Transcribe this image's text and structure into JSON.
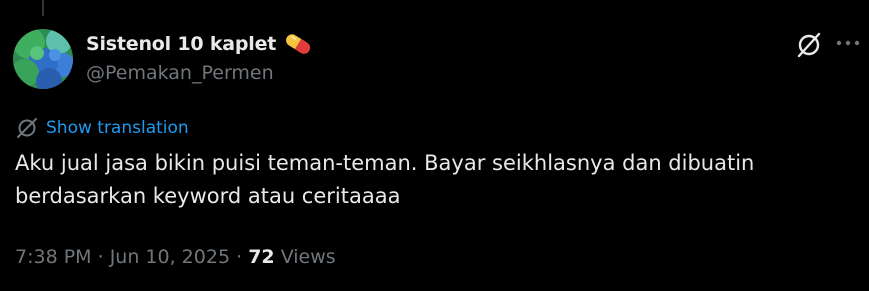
{
  "tweet": {
    "author": {
      "display_name": "Sistenol 10 kaplet",
      "emoji": "pill-icon",
      "handle": "@Pemakan_Permen"
    },
    "actions": {
      "grok_icon": "grok-icon",
      "more_icon": "more-icon"
    },
    "translate": {
      "icon": "translate-icon",
      "label": "Show translation"
    },
    "text": "Aku jual jasa bikin puisi teman-teman. Bayar seikhlasnya dan dibuatin berdasarkan keyword atau ceritaaaa",
    "meta": {
      "time": "7:38 PM",
      "separator": "·",
      "date": "Jun 10, 2025",
      "views_count": "72",
      "views_label": "Views"
    }
  },
  "colors": {
    "background": "#000000",
    "text_primary": "#e7e9ea",
    "text_secondary": "#71767b",
    "accent": "#1d9bf0"
  }
}
